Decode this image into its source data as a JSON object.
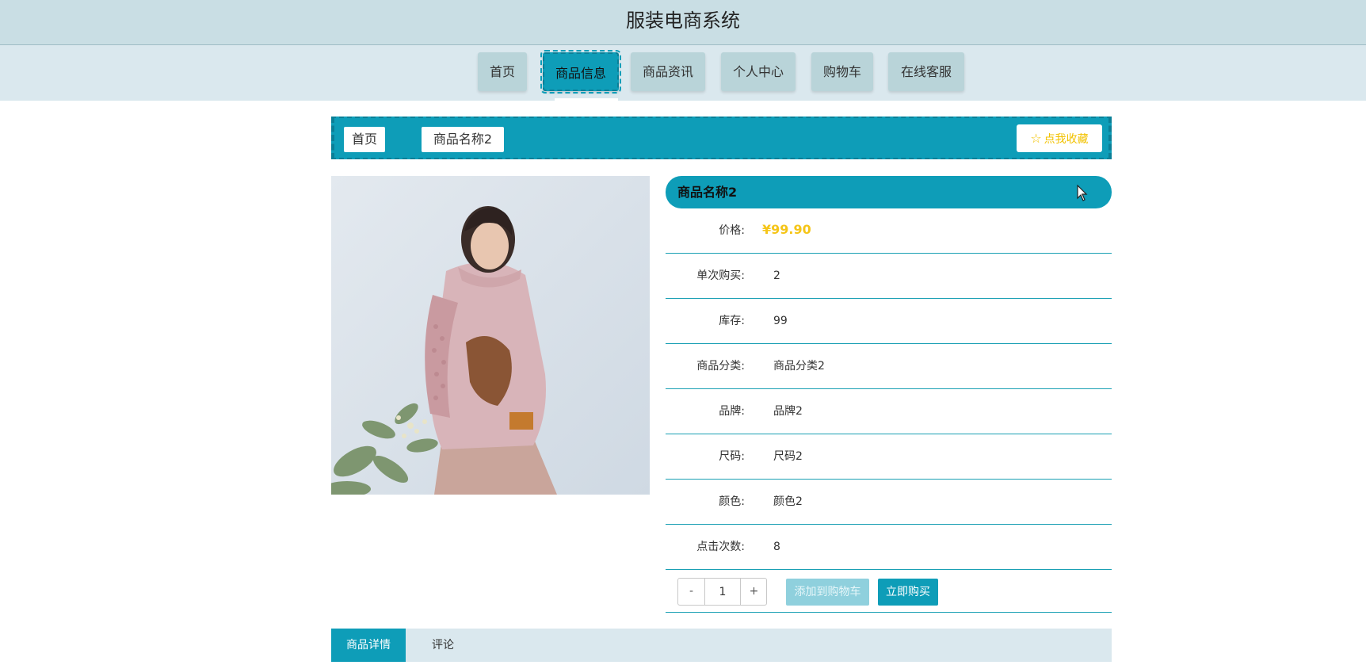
{
  "site": {
    "title": "服装电商系统"
  },
  "nav": {
    "items": [
      {
        "label": "首页"
      },
      {
        "label": "商品信息"
      },
      {
        "label": "商品资讯"
      },
      {
        "label": "个人中心"
      },
      {
        "label": "购物车"
      },
      {
        "label": "在线客服"
      }
    ],
    "active_index": 1
  },
  "breadcrumb": {
    "home": "首页",
    "current": "商品名称2",
    "favorite_label": "点我收藏"
  },
  "product": {
    "name": "商品名称2",
    "image_alt": "商品名称2",
    "fields": [
      {
        "label": "价格:",
        "value": "¥99.90"
      },
      {
        "label": "单次购买:",
        "value": "2"
      },
      {
        "label": "库存:",
        "value": "99"
      },
      {
        "label": "商品分类:",
        "value": "商品分类2"
      },
      {
        "label": "品牌:",
        "value": "品牌2"
      },
      {
        "label": "尺码:",
        "value": "尺码2"
      },
      {
        "label": "颜色:",
        "value": "颜色2"
      },
      {
        "label": "点击次数:",
        "value": "8"
      }
    ],
    "quantity": "1",
    "decrement_label": "-",
    "increment_label": "+",
    "add_to_cart_label": "添加到购物车",
    "buy_now_label": "立即购买"
  },
  "tabs": [
    {
      "label": "商品详情"
    },
    {
      "label": "评论"
    }
  ],
  "colors": {
    "accent": "#0e9db8",
    "header_bg": "#c9dee4",
    "nav_bg": "#dae8ee",
    "price": "#f5c518"
  }
}
